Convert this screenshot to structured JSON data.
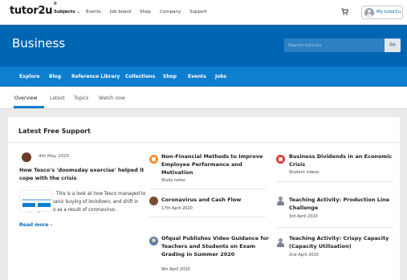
{
  "topnav": {
    "logo": "tutor2u",
    "items": [
      "Subjects",
      "Events",
      "Job board",
      "Shop",
      "Company",
      "Support"
    ],
    "account_label": "My tutor2u"
  },
  "hero": {
    "title": "Business",
    "search_placeholder": "Search tutor2u",
    "go_label": "Go"
  },
  "subnav": {
    "items": [
      "Explore",
      "Blog",
      "Reference Library",
      "Collections",
      "Shop",
      "Events",
      "Jobs"
    ]
  },
  "tabs": [
    "Overview",
    "Latest",
    "Topics",
    "Watch now"
  ],
  "card": {
    "title": "Latest Free Support",
    "featured": {
      "date": "4th May 2020",
      "title": "How Tesco's 'doomsday exercise' helped it cope with the crisis",
      "text": "This is a look at how Tesco managed to cope with the panic buying of lockdown, and shift in shopping habits as a result of coronavirus.",
      "read_more": "Read more ›"
    },
    "items": [
      {
        "title": "Non-Financial Methods to Improve Employee Performance and Motivation",
        "meta": "Study notes",
        "icon": "study-notes-icon"
      },
      {
        "title": "Coronavirus and Cash Flow",
        "meta": "17th April 2020",
        "icon": "author-avatar-icon"
      },
      {
        "title": "Ofqual Publishes Video Guidance for Teachers and Students on Exam Grading in Summer 2020",
        "meta": "9th April 2020",
        "icon": "author-avatar-icon"
      },
      {
        "title": "Business Dividends in an Economic Crisis",
        "meta": "Student videos",
        "icon": "video-icon"
      },
      {
        "title": "Teaching Activity: Production Line Challenge",
        "meta": "3rd April 2020",
        "icon": "author-avatar-icon"
      },
      {
        "title": "Teaching Activity: Crispy Capacity (Capacity Utilisation)",
        "meta": "2nd April 2020",
        "icon": "author-avatar-icon"
      }
    ]
  },
  "colors": {
    "hero_blue": "#0066b3",
    "subnav_blue": "#0e7ecf",
    "link_blue": "#0a6fc0",
    "page_bg": "#ebebeb"
  }
}
